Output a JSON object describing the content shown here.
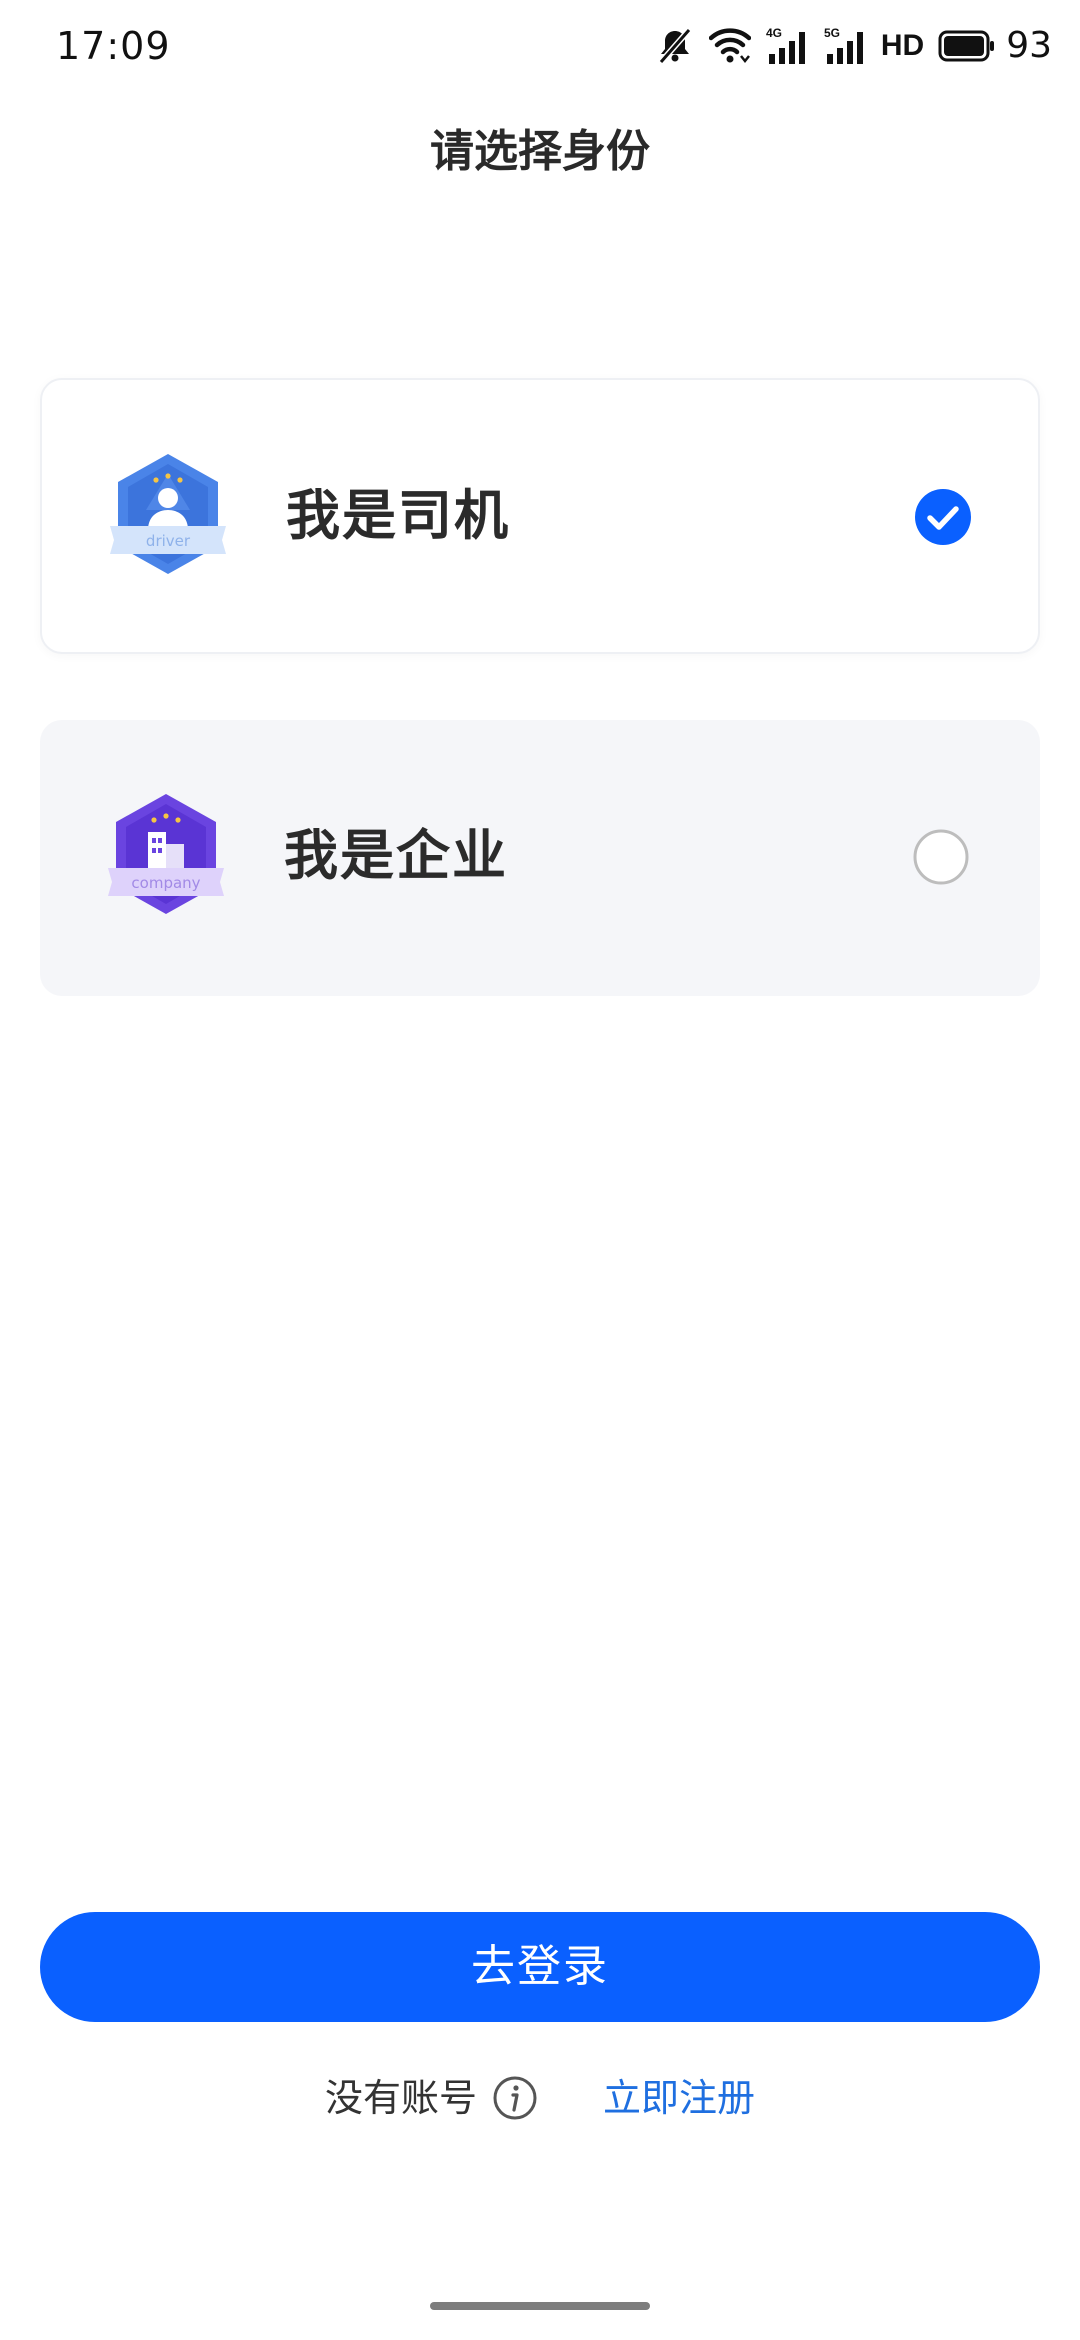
{
  "status_bar": {
    "time": "17:09",
    "network_4g_label": "4G",
    "network_5g_label": "5G",
    "hd_label": "HD",
    "battery_percent": "93",
    "icons": [
      "mute-icon",
      "wifi-icon",
      "signal-4g-icon",
      "signal-5g-icon",
      "battery-icon"
    ]
  },
  "page": {
    "title": "请选择身份"
  },
  "roles": [
    {
      "label": "我是司机",
      "badge_text": "driver",
      "badge_icon": "driver-badge-icon",
      "selected": true
    },
    {
      "label": "我是企业",
      "badge_text": "company",
      "badge_icon": "company-badge-icon",
      "selected": false
    }
  ],
  "actions": {
    "login_label": "去登录",
    "no_account_text": "没有账号",
    "info_icon": "info-icon",
    "register_label": "立即注册"
  },
  "colors": {
    "primary": "#0a60ff",
    "link": "#1f6fe0",
    "driver_badge": "#4a84e8",
    "company_badge": "#6a44e0",
    "unselected_card_bg": "#f5f6f9"
  }
}
